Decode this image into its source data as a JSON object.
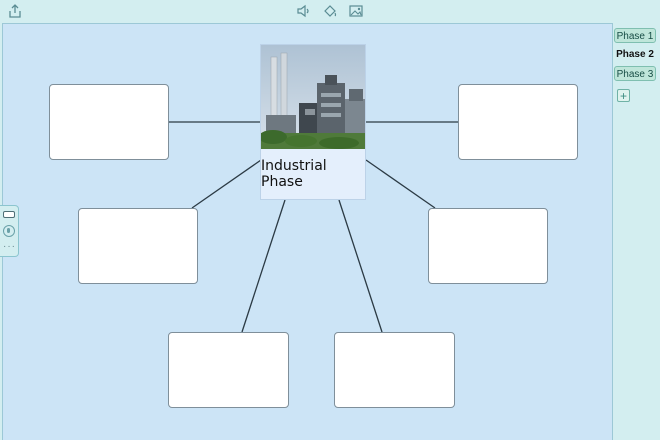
{
  "toolbar": {
    "icons": [
      "share-icon",
      "audio-icon",
      "paint-bucket-icon",
      "image-icon"
    ]
  },
  "center": {
    "title": "Industrial Phase",
    "image": "industrial-factory-photo"
  },
  "boxes": [
    {
      "id": "top-left",
      "text": ""
    },
    {
      "id": "mid-left",
      "text": ""
    },
    {
      "id": "bottom-left",
      "text": ""
    },
    {
      "id": "bottom-right",
      "text": ""
    },
    {
      "id": "mid-right",
      "text": ""
    },
    {
      "id": "top-right",
      "text": ""
    }
  ],
  "phases": {
    "tabs": [
      {
        "label": "Phase 1",
        "active": false
      },
      {
        "label": "Phase 2",
        "active": true
      },
      {
        "label": "Phase 3",
        "active": false
      }
    ],
    "add_label": "+"
  },
  "side_panel": {
    "more_label": "···"
  }
}
